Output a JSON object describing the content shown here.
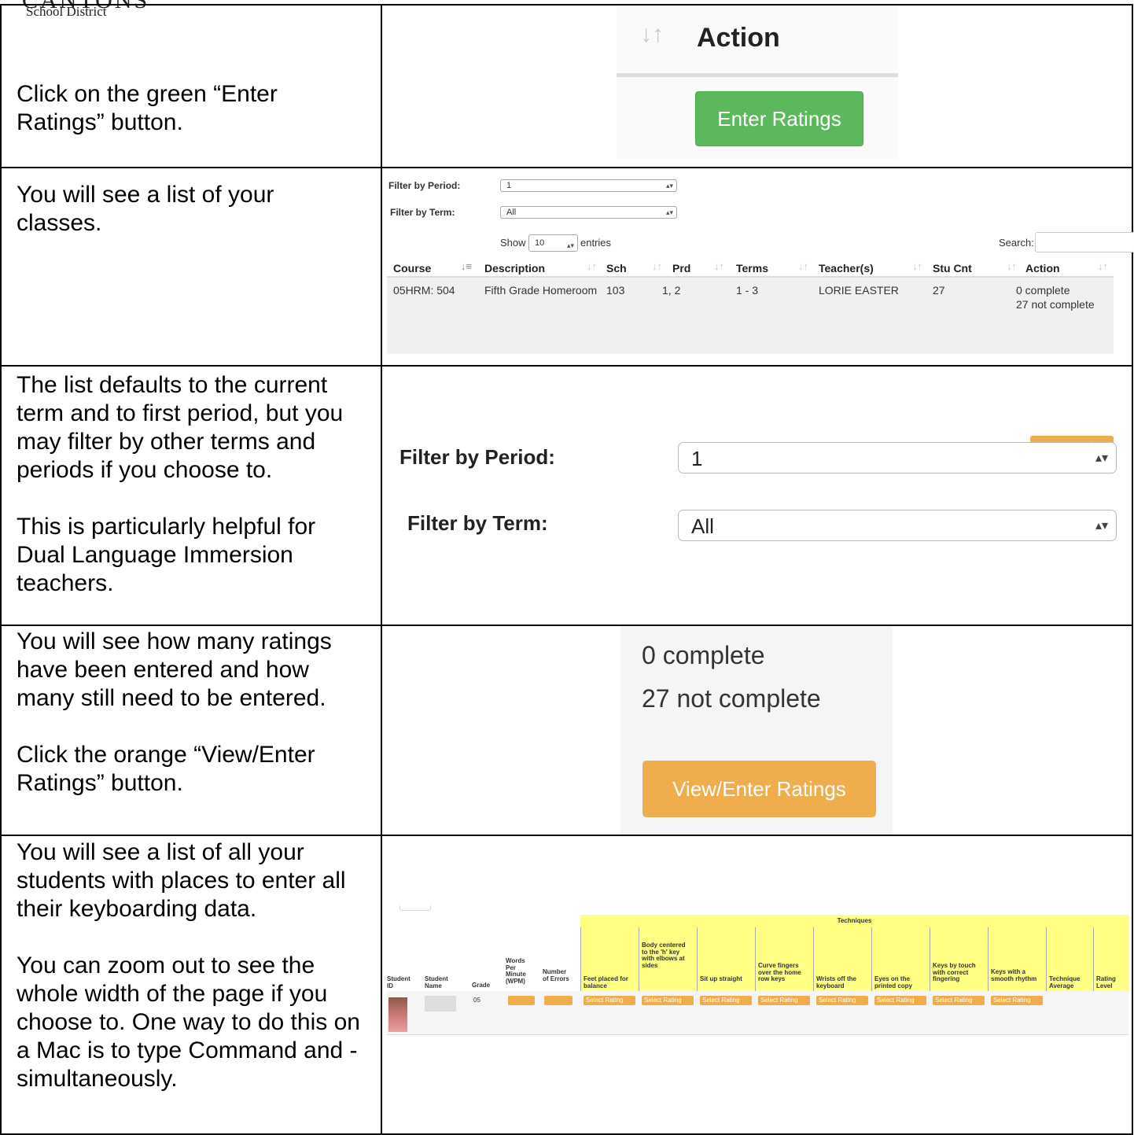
{
  "logo": {
    "name": "CANTONS",
    "district": "School District"
  },
  "rows": [
    {
      "text": [
        "Click on the green “Enter Ratings” button."
      ]
    },
    {
      "text": [
        "You will see a list of your classes."
      ]
    },
    {
      "text": [
        "The list defaults to the current term and to first period, but you may filter by other terms and periods if you choose to.",
        "This is particularly helpful for Dual Language Immersion teachers."
      ]
    },
    {
      "text": [
        "You will see how many ratings have been entered and how many still need to be entered.",
        "Click the orange “View/Enter Ratings” button."
      ]
    },
    {
      "text": [
        "You will see a list of all your students with places to enter all their keyboarding data.",
        "You can zoom out to see the whole width of the page if you choose to. One way to do this on a Mac is to type Command and - simultaneously."
      ]
    }
  ],
  "action_crop": {
    "header": "Action",
    "button": "Enter Ratings",
    "button_color": "#5cb85c"
  },
  "class_list": {
    "filter_period_label": "Filter by Period:",
    "filter_period_value": "1",
    "filter_term_label": "Filter by Term:",
    "filter_term_value": "All",
    "show_label": "Show",
    "show_value": "10",
    "entries_label": "entries",
    "search_label": "Search:",
    "columns": [
      "Course",
      "Description",
      "Sch",
      "Prd",
      "Terms",
      "Teacher(s)",
      "Stu Cnt",
      "Action"
    ],
    "row": {
      "course": "05HRM: 504",
      "description": "Fifth Grade Homeroom",
      "sch": "103",
      "prd": "1, 2",
      "terms": "1 - 3",
      "teacher": "LORIE EASTER",
      "stu_cnt": "27",
      "complete": "0 complete",
      "not_complete": "27 not complete",
      "button": "View/Enter Ratings"
    }
  },
  "filter_zoom": {
    "period_label": "Filter by Period:",
    "period_value": "1",
    "term_label": "Filter by Term:",
    "term_value": "All"
  },
  "count_zoom": {
    "complete": "0 complete",
    "not_complete": "27 not complete",
    "button": "View/Enter Ratings",
    "button_color": "#f0ad4e"
  },
  "ratings_table": {
    "group_header": "Techniques",
    "columns": [
      "Student ID",
      "Student Name",
      "Grade",
      "Words Per Minute (WPM)",
      "Number of Errors",
      "Feet placed for balance",
      "Body centered to the 'h' key with elbows at sides",
      "Sit up straight",
      "Curve fingers over the home row keys",
      "Wrists off the keyboard",
      "Eyes on the printed copy",
      "Keys by touch with correct fingering",
      "Keys with a smooth rhythm",
      "Technique Average",
      "Rating Level"
    ],
    "grade": "05",
    "select_placeholder": "Select Rating"
  }
}
